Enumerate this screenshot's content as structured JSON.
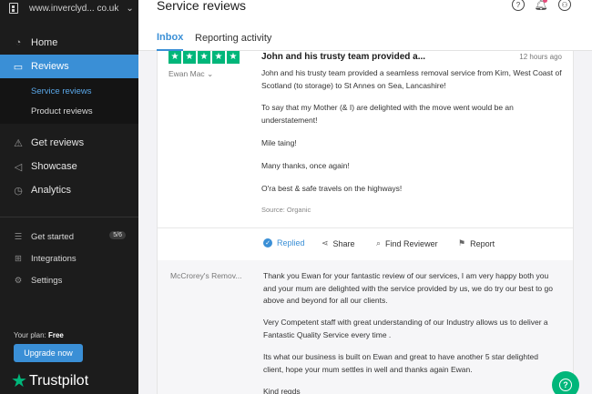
{
  "sidebar": {
    "site": "www.inverclyd... co.uk",
    "nav": [
      {
        "label": "Home",
        "icon": "dashboard-icon"
      },
      {
        "label": "Reviews",
        "icon": "inbox-icon"
      }
    ],
    "sub": [
      {
        "label": "Service reviews"
      },
      {
        "label": "Product reviews"
      }
    ],
    "nav2": [
      {
        "label": "Get reviews",
        "icon": "megaphone-icon"
      },
      {
        "label": "Showcase",
        "icon": "showcase-icon"
      },
      {
        "label": "Analytics",
        "icon": "analytics-icon"
      }
    ],
    "small": [
      {
        "label": "Get started",
        "icon": "checklist-icon",
        "badge": "5/6"
      },
      {
        "label": "Integrations",
        "icon": "integrations-icon"
      },
      {
        "label": "Settings",
        "icon": "gear-icon"
      }
    ],
    "plan_prefix": "Your plan:",
    "plan_name": "Free",
    "upgrade_label": "Upgrade now",
    "logo_text": "Trustpilot"
  },
  "header": {
    "title": "Service reviews",
    "tabs": [
      {
        "label": "Inbox"
      },
      {
        "label": "Reporting activity"
      }
    ]
  },
  "review": {
    "rating": 5,
    "reviewer": "Ewan Mac",
    "title": "John and his trusty team provided a...",
    "time": "12 hours ago",
    "paragraphs": [
      "John and his trusty team provided a seamless removal service from Kirn, West Coast of Scotland (to storage) to St Annes on Sea, Lancashire!",
      "To say that my Mother (& I) are delighted with the move went would be an understatement!",
      "Mile taing!",
      "Many thanks, once again!",
      "O'ra best & safe travels on the highways!"
    ],
    "source": "Source: Organic",
    "actions": [
      {
        "label": "Replied"
      },
      {
        "label": "Share"
      },
      {
        "label": "Find Reviewer"
      },
      {
        "label": "Report"
      }
    ]
  },
  "reply": {
    "author": "McCrorey's Remov...",
    "paragraphs": [
      "Thank you Ewan for your fantastic review of our services, I am very happy both you and your mum are delighted with the service provided by us, we do try our best to go above and beyond for all our clients.",
      "Very Competent staff with great understanding of our Industry allows us to deliver a Fantastic Quality Service every time .",
      "Its what our business is built on Ewan and great to have another 5 star delighted client, hope your mum settles in well and thanks again Ewan.",
      "Kind regds"
    ]
  },
  "colors": {
    "accent": "#3a8fd6",
    "brand_green": "#00b67a",
    "sidebar_bg": "#1c1c1c"
  }
}
